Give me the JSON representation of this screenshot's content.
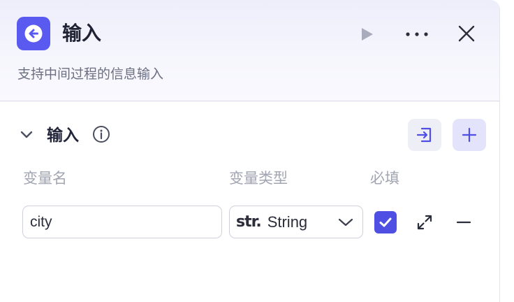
{
  "node": {
    "icon": "arrow-left-circle-icon",
    "accent_color": "#5a5af0",
    "title": "输入",
    "description": "支持中间过程的信息输入"
  },
  "header_actions": {
    "run_icon": "play-icon",
    "more_icon": "more-horizontal-icon",
    "close_icon": "close-icon"
  },
  "section": {
    "title": "输入",
    "collapse_icon": "chevron-down-icon",
    "info_icon": "info-icon",
    "import_icon": "import-icon",
    "add_icon": "plus-icon"
  },
  "columns": {
    "name": "变量名",
    "type": "变量类型",
    "required": "必填"
  },
  "rows": [
    {
      "name": "city",
      "type_prefix": "str.",
      "type_label": "String",
      "required": true
    }
  ]
}
